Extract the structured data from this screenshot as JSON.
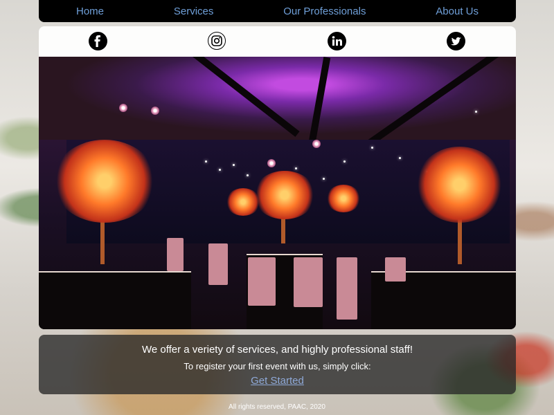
{
  "nav": {
    "items": [
      {
        "label": "Home"
      },
      {
        "label": "Services"
      },
      {
        "label": "Our Professionals"
      },
      {
        "label": "About Us"
      }
    ]
  },
  "social": {
    "icons": [
      "facebook-icon",
      "instagram-icon",
      "linkedin-icon",
      "twitter-icon"
    ]
  },
  "info": {
    "headline": "We offer a veriety of services, and highly professional staff!",
    "subtext": "To register your first event with us, simply click:",
    "cta_label": "Get Started"
  },
  "footer": {
    "text": "All rights reserved, PAAC, 2020"
  },
  "colors": {
    "nav_bg": "#000000",
    "nav_link": "#6f9fd8",
    "cta_link": "#8fa9d8"
  }
}
